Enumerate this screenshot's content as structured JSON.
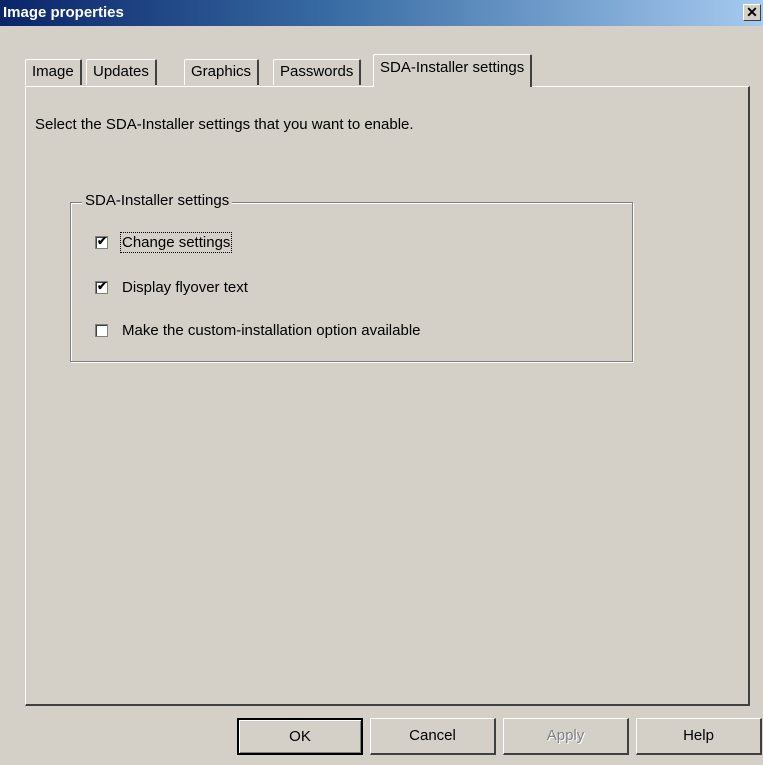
{
  "window": {
    "title": "Image properties",
    "close_glyph": "✕"
  },
  "tabs": [
    {
      "label": "Image",
      "active": false
    },
    {
      "label": "Updates",
      "active": false
    },
    {
      "label": "Graphics",
      "active": false
    },
    {
      "label": "Passwords",
      "active": false
    },
    {
      "label": "SDA-Installer settings",
      "active": true
    }
  ],
  "panel": {
    "instruction": "Select the SDA-Installer settings that you want to enable.",
    "group_label": "SDA-Installer settings",
    "options": [
      {
        "label": "Change settings",
        "checked": true,
        "focused": true
      },
      {
        "label": "Display flyover text",
        "checked": true,
        "focused": false
      },
      {
        "label": "Make the custom-installation option available",
        "checked": false,
        "focused": false
      }
    ]
  },
  "buttons": {
    "ok": "OK",
    "cancel": "Cancel",
    "apply": "Apply",
    "help": "Help"
  },
  "checkmark_glyph": "✔"
}
